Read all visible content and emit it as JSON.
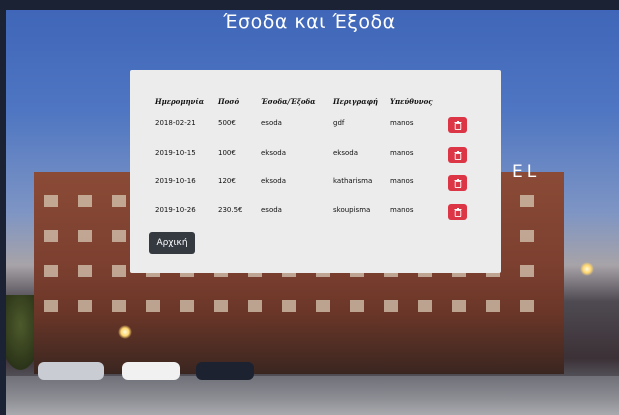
{
  "page": {
    "title": "Έσοδα και Έξοδα"
  },
  "background": {
    "sign_text": "EL"
  },
  "table": {
    "headers": [
      "Ημερομηνία",
      "Ποσό",
      "Έσοδα/Έξοδα",
      "Περιγραφή",
      "Υπεύθυνος"
    ],
    "rows": [
      {
        "date": "2018-02-21",
        "amount": "500€",
        "type": "esoda",
        "description": "gdf",
        "responsible": "manos"
      },
      {
        "date": "2019-10-15",
        "amount": "100€",
        "type": "eksoda",
        "description": "eksoda",
        "responsible": "manos"
      },
      {
        "date": "2019-10-16",
        "amount": "120€",
        "type": "eksoda",
        "description": "katharisma",
        "responsible": "manos"
      },
      {
        "date": "2019-10-26",
        "amount": "230.5€",
        "type": "esoda",
        "description": "skoupisma",
        "responsible": "manos"
      }
    ]
  },
  "buttons": {
    "home_label": "Αρχική"
  },
  "colors": {
    "delete": "#dc3545",
    "home": "#343a40",
    "panel": "#ececec"
  }
}
